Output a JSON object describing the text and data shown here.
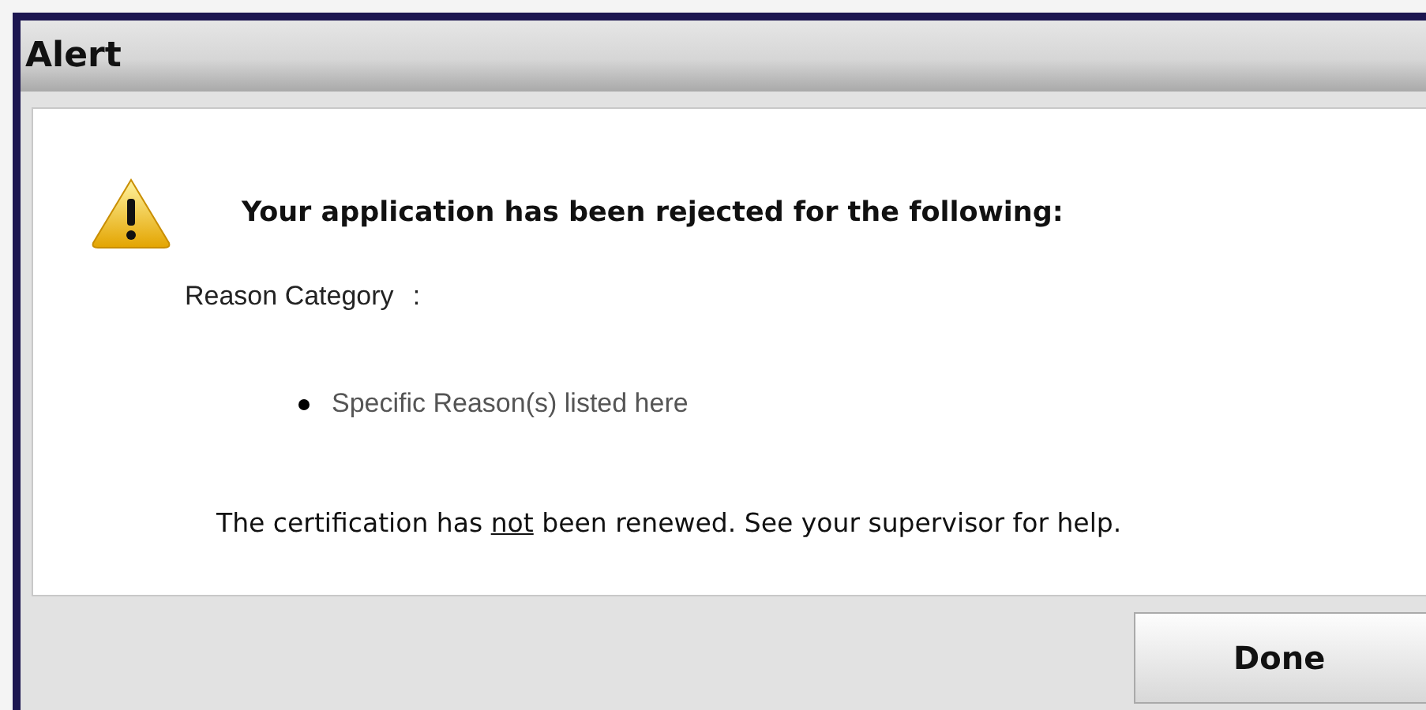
{
  "window": {
    "title": "Alert"
  },
  "heading": "Your application has been rejected for the following:",
  "reason_label": "Reason Category",
  "reason_separator": ":",
  "reasons": [
    "Specific Reason(s) listed here"
  ],
  "message": {
    "before": "The certification has ",
    "underlined": "not",
    "after": " been renewed. See your supervisor for help."
  },
  "buttons": [
    "Done"
  ]
}
